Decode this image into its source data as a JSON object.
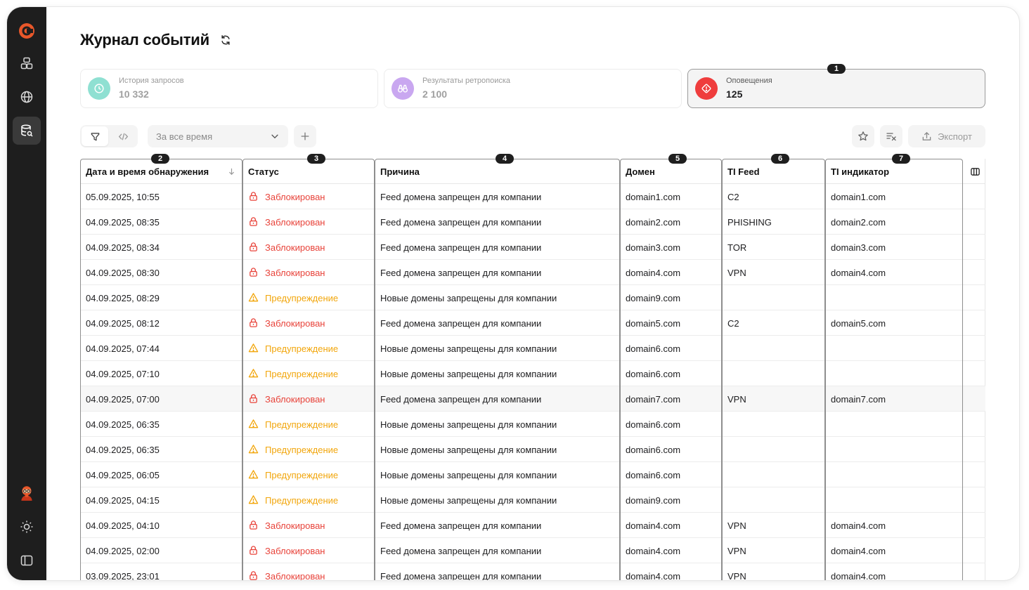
{
  "app": {
    "page_title": "Журнал событий",
    "accent": "#e8572a"
  },
  "sidebar": {
    "items": [
      "logo-icon",
      "dashboard-icon",
      "globe-icon",
      "database-search-icon",
      "avatar",
      "sun-icon",
      "panel-icon"
    ]
  },
  "cards": [
    {
      "label": "История запросов",
      "value": "10 332",
      "color": "#8fe0d2"
    },
    {
      "label": "Результаты ретропоиска",
      "value": "2 100",
      "color": "#c9a7f0"
    },
    {
      "label": "Оповещения",
      "value": "125",
      "color": "#ef3d3d",
      "badge": "1"
    }
  ],
  "toolbar": {
    "period": "За все время",
    "export_label": "Экспорт"
  },
  "columns": [
    {
      "label": "Дата и время обнаружения",
      "badge": "2"
    },
    {
      "label": "Статус",
      "badge": "3"
    },
    {
      "label": "Причина",
      "badge": "4"
    },
    {
      "label": "Домен",
      "badge": "5"
    },
    {
      "label": "TI Feed",
      "badge": "6"
    },
    {
      "label": "TI индикатор",
      "badge": "7"
    }
  ],
  "rows": [
    {
      "date": "05.09.2025, 10:55",
      "status": "blocked",
      "status_label": "Заблокирован",
      "reason": "Feed домена запрещен для компании",
      "domain": "domain1.com",
      "feed": "C2",
      "indicator": "domain1.com"
    },
    {
      "date": "04.09.2025, 08:35",
      "status": "blocked",
      "status_label": "Заблокирован",
      "reason": "Feed домена запрещен для компании",
      "domain": "domain2.com",
      "feed": "PHISHING",
      "indicator": "domain2.com"
    },
    {
      "date": "04.09.2025, 08:34",
      "status": "blocked",
      "status_label": "Заблокирован",
      "reason": "Feed домена запрещен для компании",
      "domain": "domain3.com",
      "feed": "TOR",
      "indicator": "domain3.com"
    },
    {
      "date": "04.09.2025, 08:30",
      "status": "blocked",
      "status_label": "Заблокирован",
      "reason": "Feed домена запрещен для компании",
      "domain": "domain4.com",
      "feed": "VPN",
      "indicator": "domain4.com"
    },
    {
      "date": "04.09.2025, 08:29",
      "status": "warning",
      "status_label": "Предупреждение",
      "reason": "Новые домены запрещены для компании",
      "domain": "domain9.com",
      "feed": "",
      "indicator": ""
    },
    {
      "date": "04.09.2025, 08:12",
      "status": "blocked",
      "status_label": "Заблокирован",
      "reason": "Feed домена запрещен для компании",
      "domain": "domain5.com",
      "feed": "C2",
      "indicator": "domain5.com"
    },
    {
      "date": "04.09.2025, 07:44",
      "status": "warning",
      "status_label": "Предупреждение",
      "reason": "Новые домены запрещены для компании",
      "domain": "domain6.com",
      "feed": "",
      "indicator": ""
    },
    {
      "date": "04.09.2025, 07:10",
      "status": "warning",
      "status_label": "Предупреждение",
      "reason": "Новые домены запрещены для компании",
      "domain": "domain6.com",
      "feed": "",
      "indicator": ""
    },
    {
      "date": "04.09.2025, 07:00",
      "status": "blocked",
      "status_label": "Заблокирован",
      "reason": "Feed домена запрещен для компании",
      "domain": "domain7.com",
      "feed": "VPN",
      "indicator": "domain7.com",
      "highlight": true
    },
    {
      "date": "04.09.2025, 06:35",
      "status": "warning",
      "status_label": "Предупреждение",
      "reason": "Новые домены запрещены для компании",
      "domain": "domain6.com",
      "feed": "",
      "indicator": ""
    },
    {
      "date": "04.09.2025, 06:35",
      "status": "warning",
      "status_label": "Предупреждение",
      "reason": "Новые домены запрещены для компании",
      "domain": "domain6.com",
      "feed": "",
      "indicator": ""
    },
    {
      "date": "04.09.2025, 06:05",
      "status": "warning",
      "status_label": "Предупреждение",
      "reason": "Новые домены запрещены для компании",
      "domain": "domain6.com",
      "feed": "",
      "indicator": ""
    },
    {
      "date": "04.09.2025, 04:15",
      "status": "warning",
      "status_label": "Предупреждение",
      "reason": "Новые домены запрещены для компании",
      "domain": "domain9.com",
      "feed": "",
      "indicator": ""
    },
    {
      "date": "04.09.2025, 04:10",
      "status": "blocked",
      "status_label": "Заблокирован",
      "reason": "Feed домена запрещен для компании",
      "domain": "domain4.com",
      "feed": "VPN",
      "indicator": "domain4.com"
    },
    {
      "date": "04.09.2025, 02:00",
      "status": "blocked",
      "status_label": "Заблокирован",
      "reason": "Feed домена запрещен для компании",
      "domain": "domain4.com",
      "feed": "VPN",
      "indicator": "domain4.com"
    },
    {
      "date": "03.09.2025, 23:01",
      "status": "blocked",
      "status_label": "Заблокирован",
      "reason": "Feed домена запрещен для компании",
      "domain": "domain4.com",
      "feed": "VPN",
      "indicator": "domain4.com"
    }
  ],
  "colors": {
    "blocked": "#e8433a",
    "warning": "#f2a60c"
  }
}
